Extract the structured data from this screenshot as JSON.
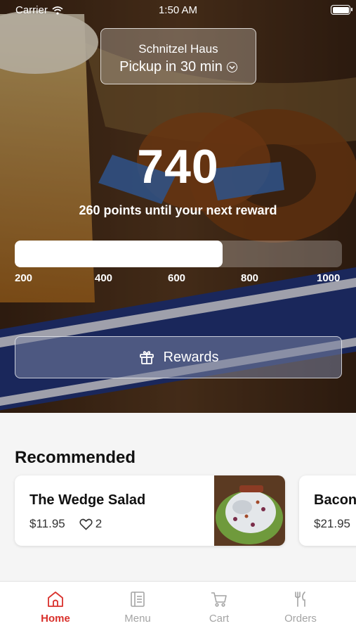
{
  "status_bar": {
    "carrier": "Carrier",
    "time": "1:50 AM"
  },
  "store": {
    "name": "Schnitzel Haus",
    "pickup": "Pickup in 30 min"
  },
  "loyalty": {
    "points": "740",
    "until_next": "260 points until your next reward",
    "progress_fraction": 0.635,
    "ticks": [
      "200",
      "400",
      "600",
      "800",
      "1000"
    ]
  },
  "rewards_button": {
    "label": "Rewards"
  },
  "recommended": {
    "title": "Recommended",
    "items": [
      {
        "name": "The Wedge Salad",
        "price": "$11.95",
        "likes": "2"
      },
      {
        "name": "Bacon",
        "price": "$21.95"
      }
    ]
  },
  "tabs": [
    {
      "label": "Home",
      "icon": "home-icon",
      "active": true
    },
    {
      "label": "Menu",
      "icon": "menu-icon",
      "active": false
    },
    {
      "label": "Cart",
      "icon": "cart-icon",
      "active": false
    },
    {
      "label": "Orders",
      "icon": "orders-icon",
      "active": false
    }
  ],
  "colors": {
    "accent": "#d9302b",
    "inactive_tab": "#a4a4a4"
  }
}
